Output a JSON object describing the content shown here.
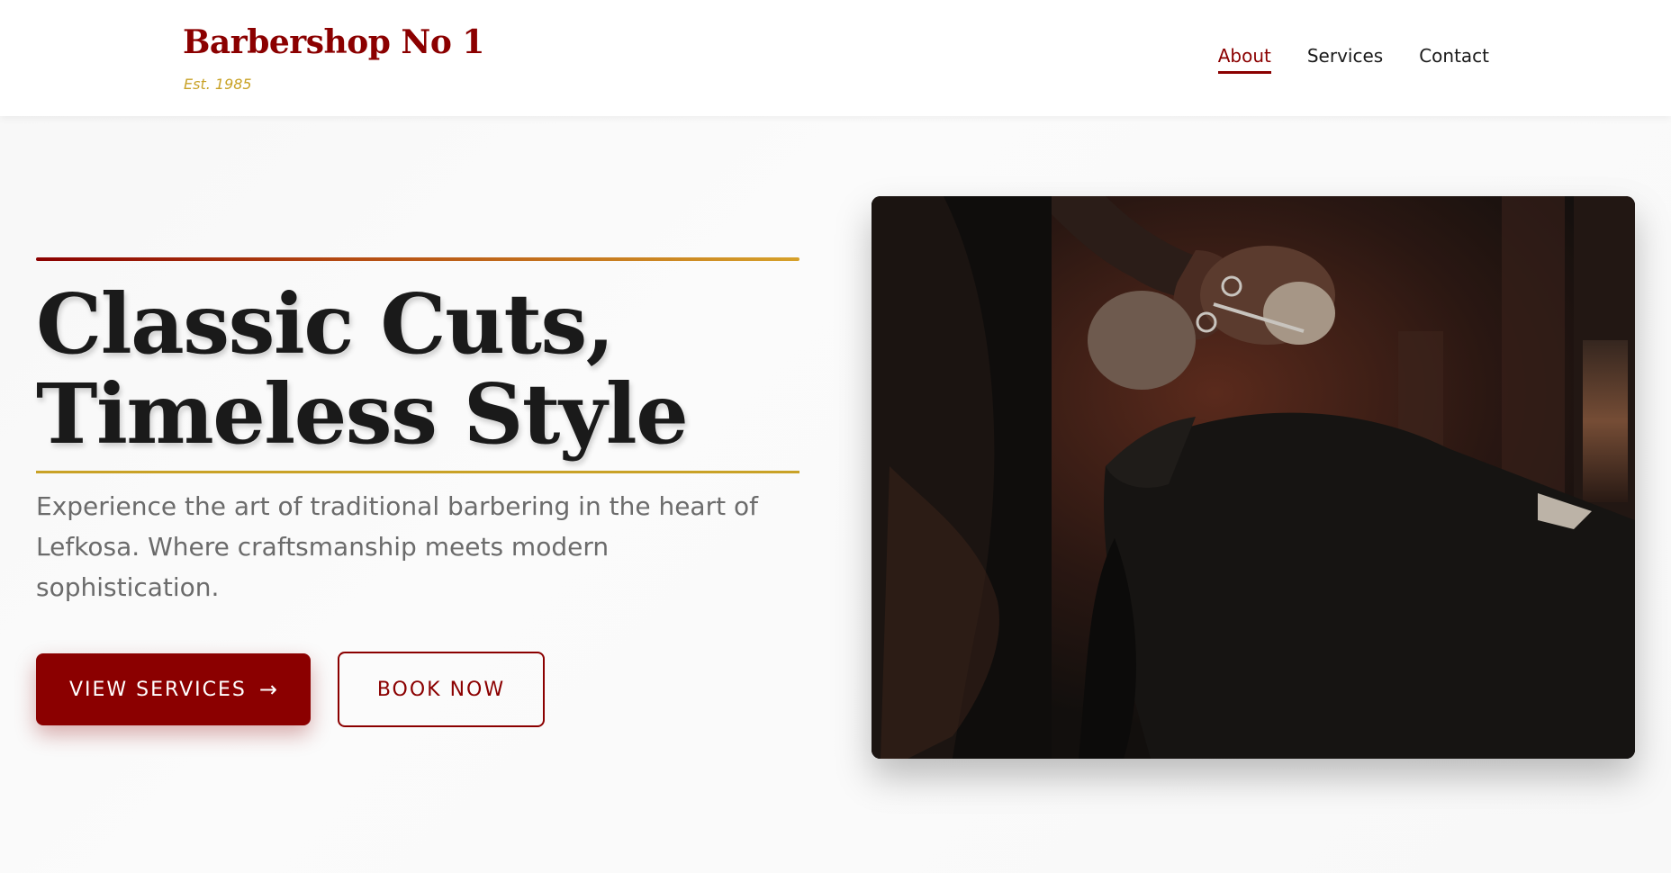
{
  "header": {
    "brand_name": "Barbershop No 1",
    "tagline": "Est. 1985",
    "nav": [
      {
        "label": "About",
        "active": true
      },
      {
        "label": "Services",
        "active": false
      },
      {
        "label": "Contact",
        "active": false
      }
    ]
  },
  "hero": {
    "title_line1": "Classic Cuts,",
    "title_line2": "Timeless Style",
    "description": "Experience the art of traditional barbering in the heart of Lefkosa. Where craftsmanship meets modern sophistication.",
    "primary_button": "VIEW SERVICES",
    "primary_button_icon": "arrow-right-icon",
    "secondary_button": "BOOK NOW"
  },
  "colors": {
    "brand": "#8b0000",
    "accent_gold": "#c9a227",
    "text_dark": "#1a1a1a",
    "text_muted": "#6b6b6b"
  }
}
